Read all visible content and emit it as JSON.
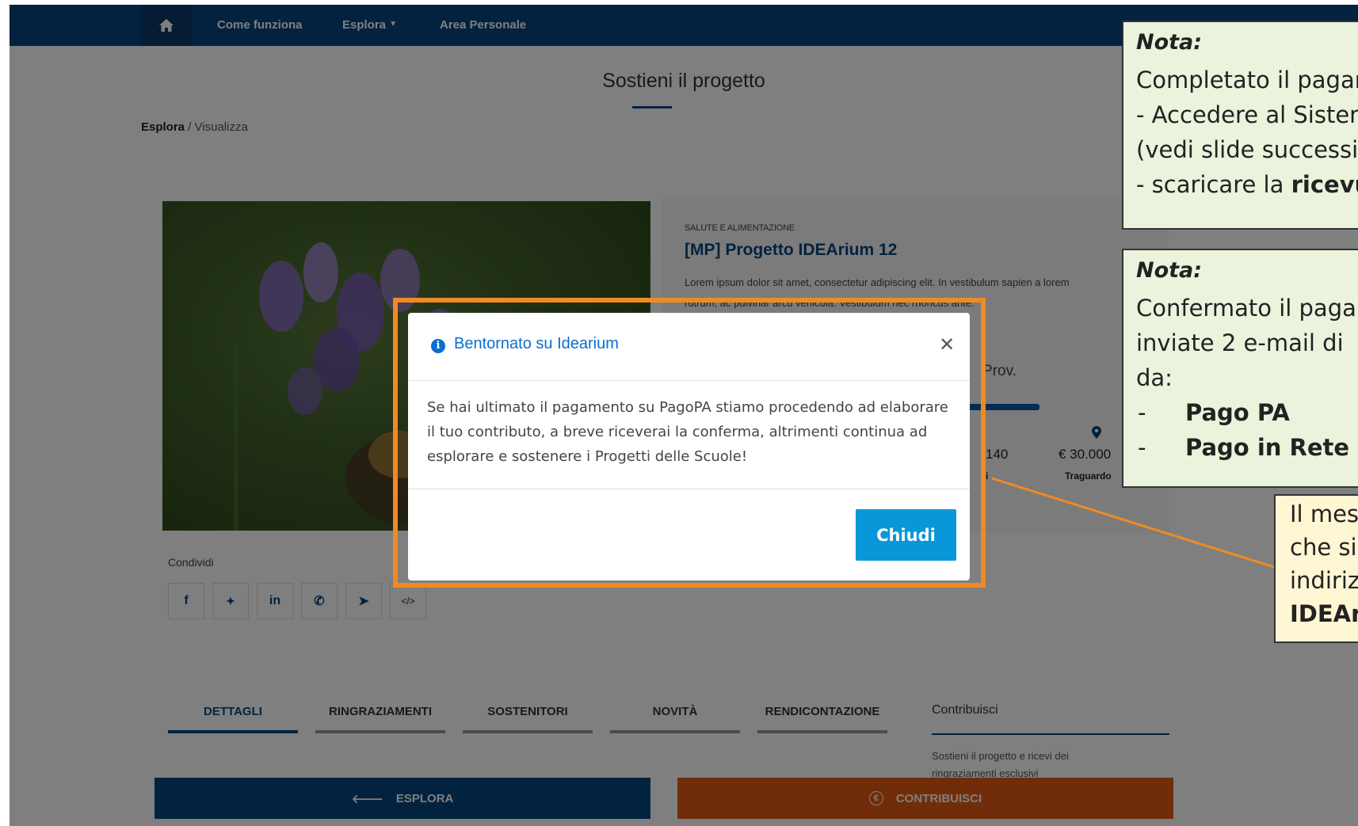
{
  "navbar": {
    "home_icon": "home-icon",
    "links": [
      "Come funziona",
      "Esplora",
      "Area Personale"
    ],
    "dropdown_icon": "caret-down-icon"
  },
  "page": {
    "title": "Sostieni il progetto",
    "breadcrumb_root": "Esplora",
    "breadcrumb_current": "/ Visualizza"
  },
  "project": {
    "category": "SALUTE E ALIMENTAZIONE",
    "title": "[MP] Progetto IDEArium 12",
    "description_line1": "Lorem ipsum dolor sit amet, consectetur adipiscing elit. In vestibulum sapien a lorem",
    "description_line2": "rutrum, ac pulvinar arcu vehicula. Vestibulum nec rhoncus ante.",
    "location": "Prov.",
    "stat1_value": "140",
    "stat1_label": "ti",
    "stat2_value": "€ 30.000",
    "stat2_label": "Traguardo",
    "progress_fraction": 0.55
  },
  "share": {
    "label": "Condividi",
    "icons": [
      "facebook-icon",
      "twitter-icon",
      "linkedin-icon",
      "whatsapp-icon",
      "telegram-icon",
      "embed-icon"
    ],
    "glyphs": [
      "f",
      "🐦",
      "in",
      "✆",
      "➤",
      "</>"
    ]
  },
  "tabs": [
    "DETTAGLI",
    "RINGRAZIAMENTI",
    "SOSTENITORI",
    "NOVITÀ",
    "RENDICONTAZIONE"
  ],
  "contrib": {
    "heading": "Contribuisci",
    "text": "Sostieni il progetto e ricevi dei ringraziamenti esclusivi"
  },
  "bottom": {
    "esplora": "ESPLORA",
    "contribuisci": "CONTRIBUISCI"
  },
  "modal": {
    "title": "Bentornato su Idearium",
    "body": "Se hai ultimato il pagamento su PagoPA stiamo procedendo ad elaborare il tuo contributo, a breve riceverai la conferma, altrimenti continua ad esplorare e sostenere i Progetti delle Scuole!",
    "close_button": "Chiudi"
  },
  "notes": {
    "note1": {
      "title": "Nota:",
      "line1": "Completato il pagamento",
      "line2": "- Accedere al Sistema",
      "line3": "(vedi slide successive)",
      "line4_prefix": "- scaricare la ",
      "line4_bold": "ricevuta"
    },
    "note2": {
      "title": "Nota:",
      "line1": "Confermato il pagamento",
      "line2": "inviate 2 e-mail di",
      "line3": "da:",
      "item1": "Pago PA",
      "item2": "Pago in Rete"
    },
    "note3": {
      "line1": "Il messaggio",
      "line2": "che si",
      "line3": "indirizzo",
      "line4": "IDEArium"
    }
  },
  "colors": {
    "navbar": "#06457f",
    "accent_orange": "#f08a24",
    "button_blue": "#0a97d9",
    "contribuisci": "#e35a12"
  }
}
